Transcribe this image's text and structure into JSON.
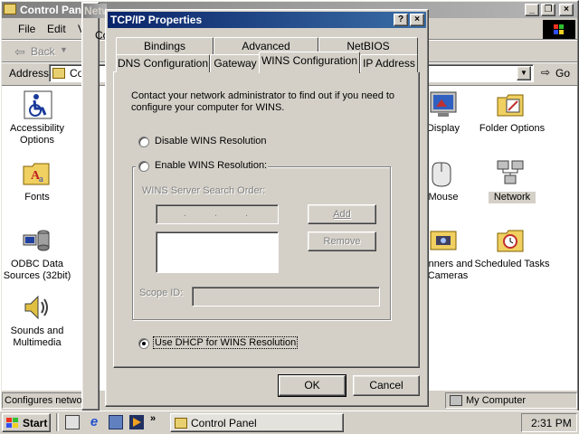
{
  "control_panel": {
    "title": "Control Panel",
    "menu": [
      "File",
      "Edit",
      "V"
    ],
    "back_label": "Back",
    "address_label": "Address",
    "address_value": "Co",
    "go_label": "Go",
    "status_left": "Configures networ",
    "status_right": "My Computer",
    "icons_left": [
      {
        "icon": "wheelchair-icon",
        "label": "Accessibility Options"
      },
      {
        "icon": "fonts-folder-icon",
        "label": "Fonts"
      },
      {
        "icon": "odbc-icon",
        "label": "ODBC Data Sources (32bit)"
      },
      {
        "icon": "speaker-icon",
        "label": "Sounds and Multimedia"
      }
    ],
    "icons_right": [
      {
        "icon": "display-icon",
        "label": "Display"
      },
      {
        "icon": "folder-options-icon",
        "label": "Folder Options"
      },
      {
        "icon": "mouse-icon",
        "label": "Mouse"
      },
      {
        "icon": "network-icon",
        "label": "Network"
      },
      {
        "icon": "scanner-icon",
        "label": "anners and Cameras"
      },
      {
        "icon": "scheduled-tasks-icon",
        "label": "Scheduled Tasks"
      }
    ]
  },
  "network_window": {
    "title": "Network",
    "partial_label": "Co"
  },
  "dialog": {
    "title": "TCP/IP Properties",
    "help_label": "?",
    "close_label": "×",
    "tabs_back": [
      "Bindings",
      "Advanced",
      "NetBIOS"
    ],
    "tabs_front": [
      "DNS Configuration",
      "Gateway",
      "WINS Configuration",
      "IP Address"
    ],
    "active_tab": "WINS Configuration",
    "intro": "Contact your network administrator to find out if you need to configure your computer for WINS.",
    "option_disable": "Disable WINS Resolution",
    "option_enable": "Enable WINS Resolution:",
    "server_order_label": "WINS Server Search Order:",
    "add_label": "Add",
    "remove_label": "Remove",
    "scope_label": "Scope ID:",
    "option_dhcp": "Use DHCP for WINS Resolution",
    "selected_option": "dhcp",
    "ok_label": "OK",
    "cancel_label": "Cancel"
  },
  "taskbar": {
    "start_label": "Start",
    "task_label": "Control Panel",
    "clock": "2:31 PM"
  },
  "colors": {
    "face": "#d4d0c8",
    "title_active": "#0a246a",
    "title_inactive": "#808080",
    "desktop_window": "#ffffff"
  }
}
